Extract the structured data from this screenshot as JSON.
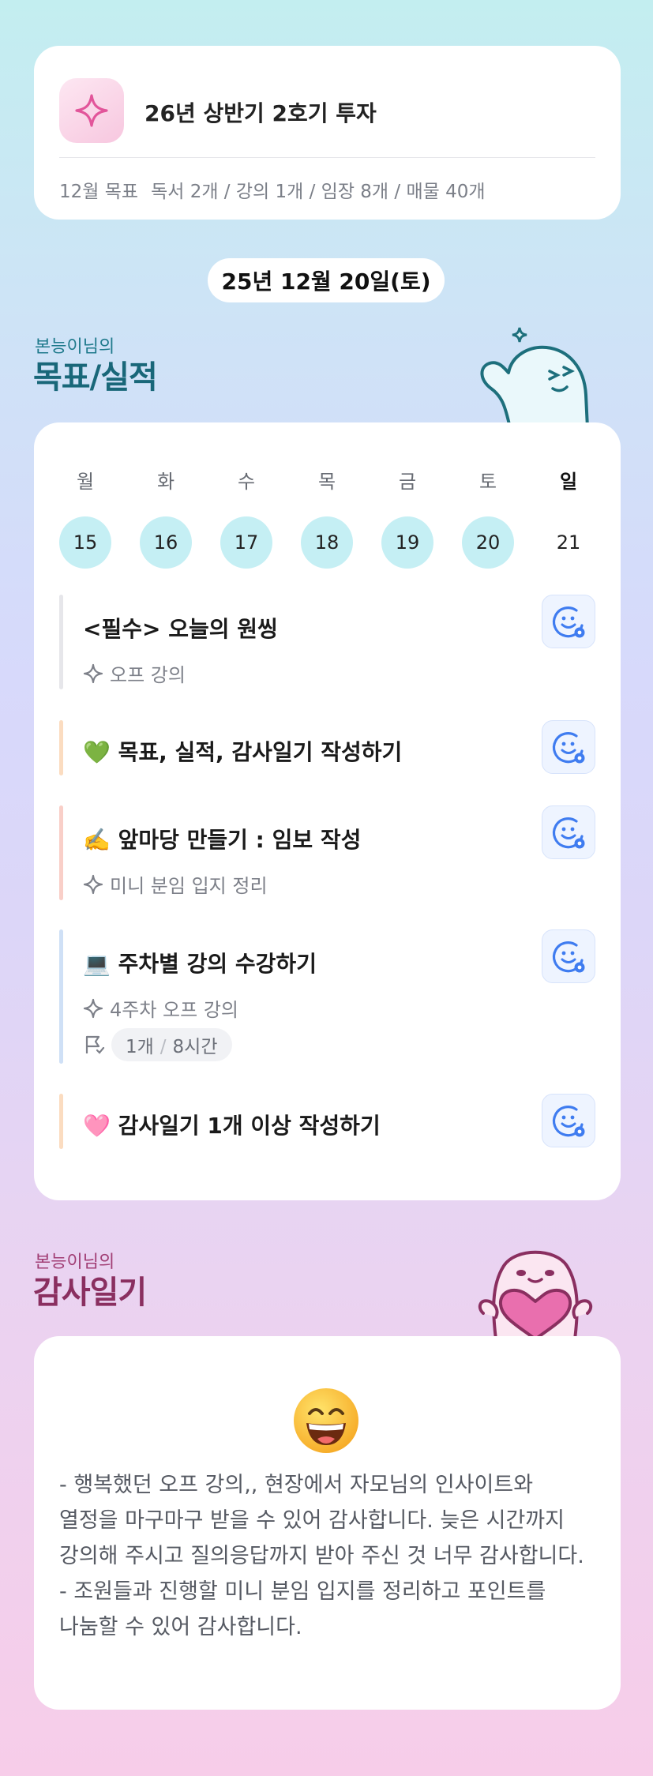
{
  "goal_card": {
    "title": "26년 상반기 2호기 투자",
    "icon": "sparkle-icon",
    "monthly_label": "12월 목표",
    "monthly_goals": "독서 2개 / 강의 1개 / 임장 8개 / 매물 40개"
  },
  "date": "25년 12월 20일(토)",
  "goals_section": {
    "subtitle": "본능이님의",
    "title": "목표/실적"
  },
  "week": [
    {
      "day": "월",
      "date": "15",
      "checked": true
    },
    {
      "day": "화",
      "date": "16",
      "checked": true
    },
    {
      "day": "수",
      "date": "17",
      "checked": true
    },
    {
      "day": "목",
      "date": "18",
      "checked": true
    },
    {
      "day": "금",
      "date": "19",
      "checked": true
    },
    {
      "day": "토",
      "date": "20",
      "checked": true
    },
    {
      "day": "일",
      "date": "21",
      "checked": false
    }
  ],
  "tasks": [
    {
      "title": "<필수> 오늘의 원씽",
      "sub": "오프 강의",
      "bar_color": "#e6e6ea"
    },
    {
      "title": "💚 목표, 실적, 감사일기 작성하기",
      "bar_color": "#fbdcc0"
    },
    {
      "title": "✍️ 앞마당 만들기 : 임보 작성",
      "sub": "미니 분임 입지 정리",
      "bar_color": "#f9cfc8"
    },
    {
      "title": "💻 주차별 강의 수강하기",
      "sub": "4주차 오프 강의",
      "progress_done": "1개",
      "progress_total": "8시간",
      "bar_color": "#cfe0f6"
    },
    {
      "title": "🩷 감사일기 1개 이상 작성하기",
      "bar_color": "#fbdcc0"
    }
  ],
  "gratitude_section": {
    "subtitle": "본능이님의",
    "title": "감사일기"
  },
  "gratitude": {
    "emoji": "grinning-face-icon",
    "text": "- 행복했던 오프 강의,, 현장에서 자모님의 인사이트와 열정을 마구마구 받을 수 있어 감사합니다. 늦은 시간까지 강의해 주시고 질의응답까지 받아 주신 것 너무 감사합니다.\n- 조원들과 진행할 미니 분임 입지를 정리하고 포인트를 나눔할 수 있어 감사합니다."
  },
  "colors": {
    "accent_blue": "#3f7cf0",
    "teal": "#1f7a8c",
    "plum": "#a13d74",
    "day_checked": "#c5eff4"
  }
}
